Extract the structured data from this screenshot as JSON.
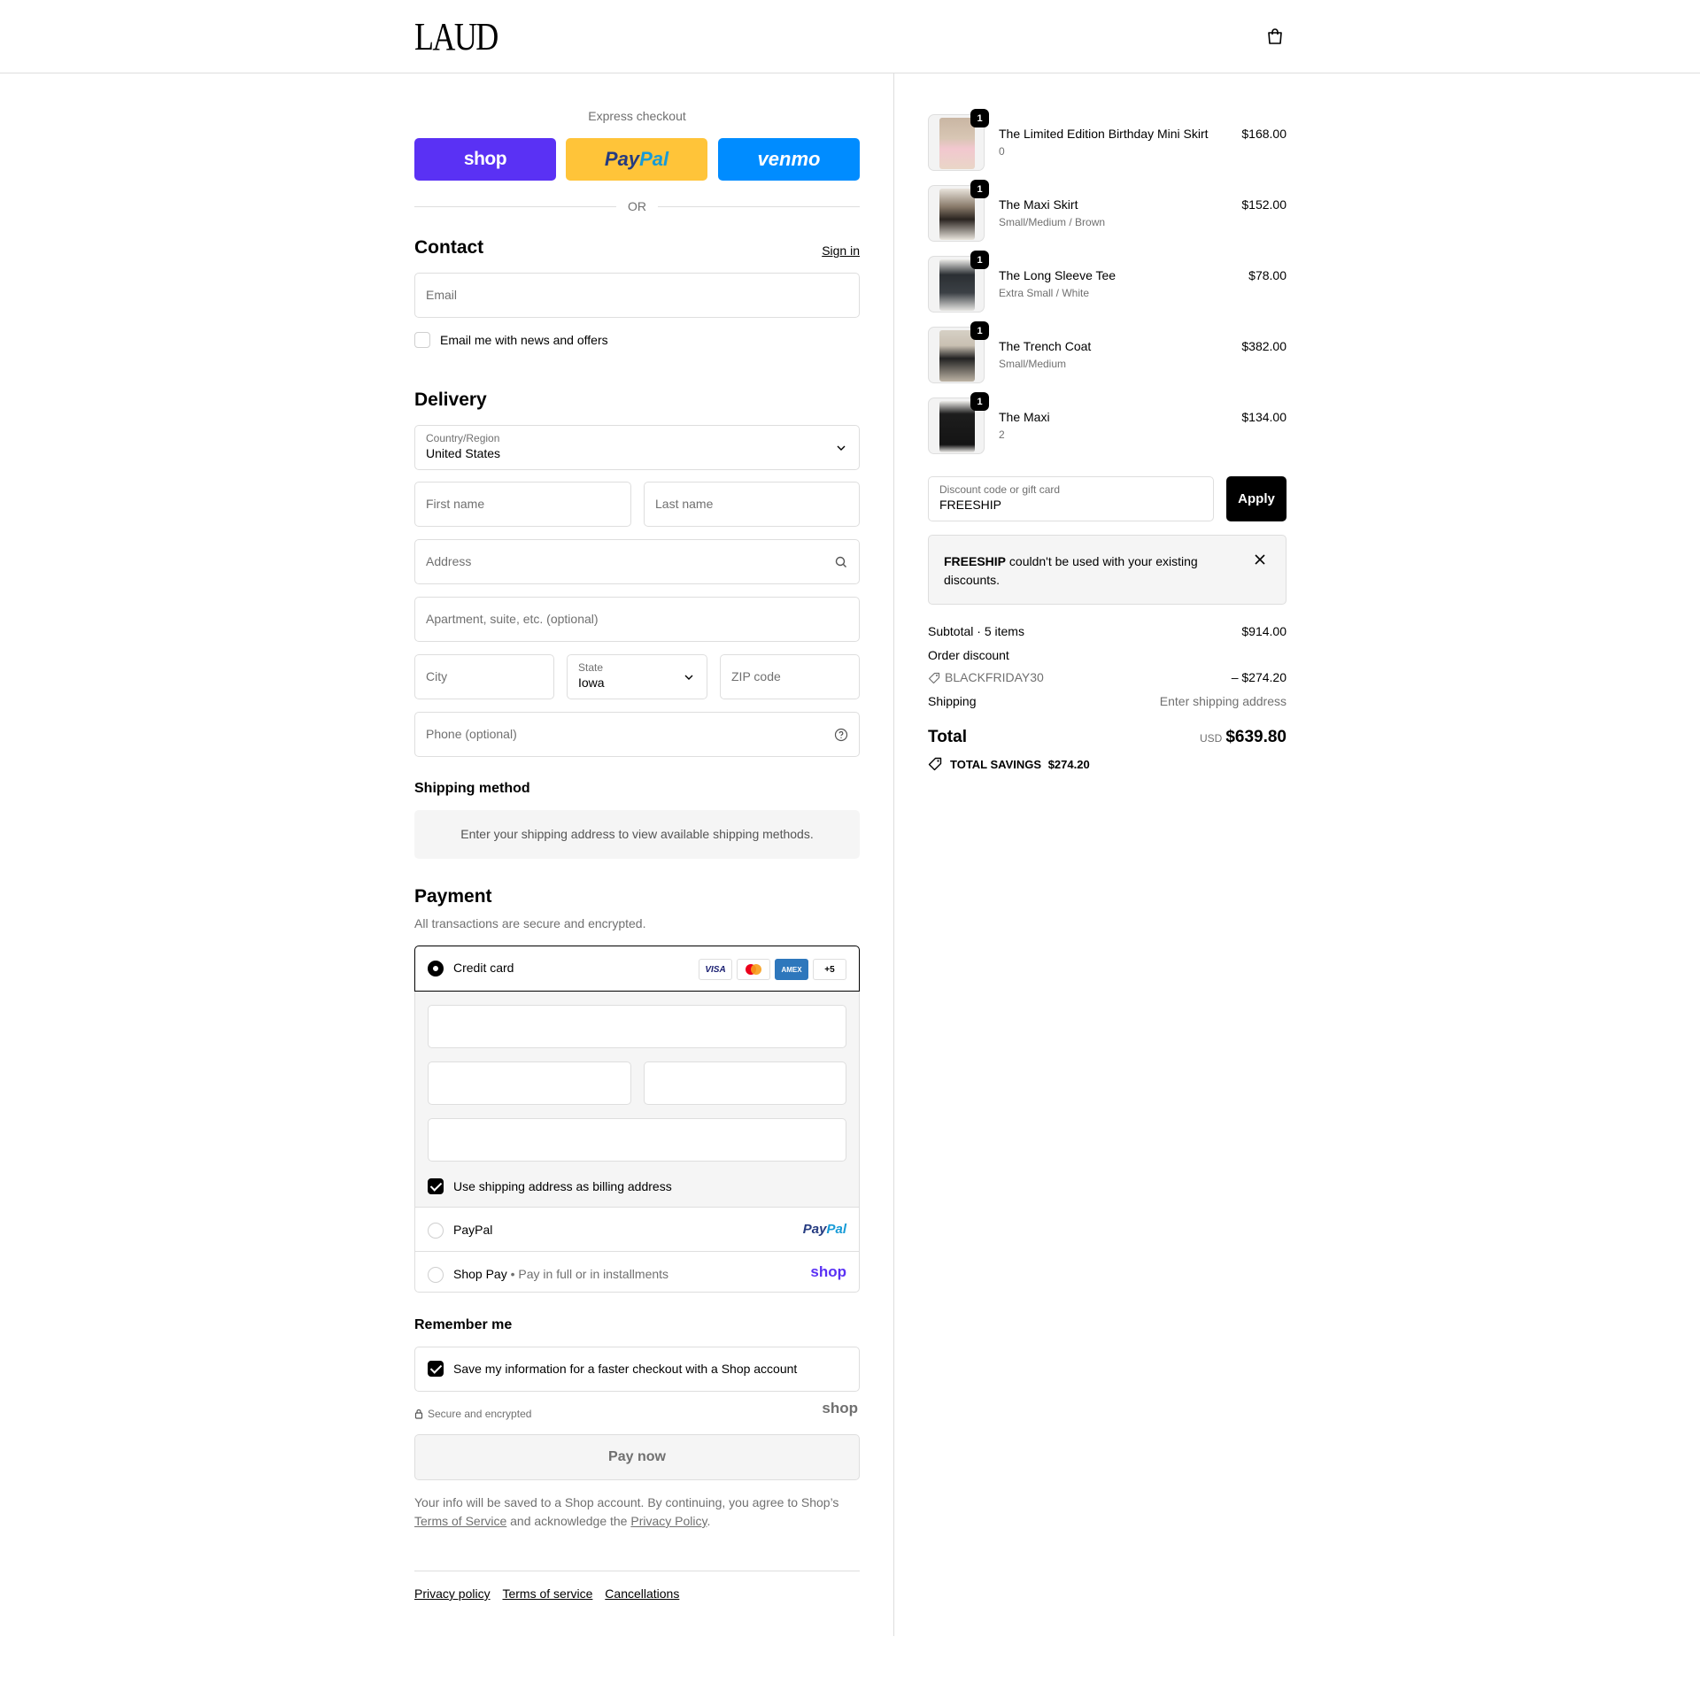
{
  "header": {
    "logo": "LAUD"
  },
  "express": {
    "label": "Express checkout",
    "shop_label": "shop",
    "paypal_label_1": "Pay",
    "paypal_label_2": "Pal",
    "venmo_label": "venmo",
    "or_label": "OR"
  },
  "contact": {
    "title": "Contact",
    "sign_in": "Sign in",
    "email_placeholder": "Email",
    "news_label": "Email me with news and offers"
  },
  "delivery": {
    "title": "Delivery",
    "country_label": "Country/Region",
    "country_value": "United States",
    "first_name": "First name",
    "last_name": "Last name",
    "address": "Address",
    "apartment": "Apartment, suite, etc. (optional)",
    "city": "City",
    "state_label": "State",
    "state_value": "Iowa",
    "zip": "ZIP code",
    "phone": "Phone (optional)"
  },
  "shipping_method": {
    "title": "Shipping method",
    "message": "Enter your shipping address to view available shipping methods."
  },
  "payment": {
    "title": "Payment",
    "subtitle": "All transactions are secure and encrypted.",
    "credit_card": "Credit card",
    "card_brands": [
      "VISA",
      "AMEX",
      "+5"
    ],
    "billing_label": "Use shipping address as billing address",
    "paypal": "PayPal",
    "paypal_logo_1": "Pay",
    "paypal_logo_2": "Pal",
    "shop_pay": "Shop Pay",
    "shop_pay_sub": "Pay in full or in installments",
    "shop_logo": "shop"
  },
  "remember": {
    "title": "Remember me",
    "save_label": "Save my information for a faster checkout with a Shop account",
    "secure": "Secure and encrypted",
    "shop_logo": "shop"
  },
  "pay_now": "Pay now",
  "legal": {
    "text1": "Your info will be saved to a Shop account. By continuing, you agree to Shop’s",
    "tos": "Terms of Service",
    "text2": "and acknowledge the",
    "privacy": "Privacy Policy",
    "period": "."
  },
  "footer": {
    "links": [
      "Privacy policy",
      "Terms of service",
      "Cancellations"
    ]
  },
  "cart": {
    "items": [
      {
        "qty": "1",
        "name": "The Limited Edition Birthday Mini Skirt",
        "variant": "0",
        "price": "$168.00"
      },
      {
        "qty": "1",
        "name": "The Maxi Skirt",
        "variant": "Small/Medium / Brown",
        "price": "$152.00"
      },
      {
        "qty": "1",
        "name": "The Long Sleeve Tee",
        "variant": "Extra Small / White",
        "price": "$78.00"
      },
      {
        "qty": "1",
        "name": "The Trench Coat",
        "variant": "Small/Medium",
        "price": "$382.00"
      },
      {
        "qty": "1",
        "name": "The Maxi",
        "variant": "2",
        "price": "$134.00"
      }
    ],
    "discount_label": "Discount code or gift card",
    "discount_value": "FREESHIP",
    "apply": "Apply",
    "notice_code": "FREESHIP",
    "notice_text_1": "couldn't be used with your existing",
    "notice_text_2": "discounts.",
    "subtotal_label": "Subtotal · 5 items",
    "subtotal_value": "$914.00",
    "order_discount_label": "Order discount",
    "discount_code": "BLACKFRIDAY30",
    "discount_amount": "– $274.20",
    "shipping_label": "Shipping",
    "shipping_value": "Enter shipping address",
    "total_label": "Total",
    "currency": "USD",
    "total_value": "$639.80",
    "savings_label": "TOTAL SAVINGS",
    "savings_value": "$274.20"
  },
  "colors": {
    "shop_purple": "#5a31f4",
    "paypal_yellow": "#ffc439",
    "venmo_blue": "#008cff"
  }
}
